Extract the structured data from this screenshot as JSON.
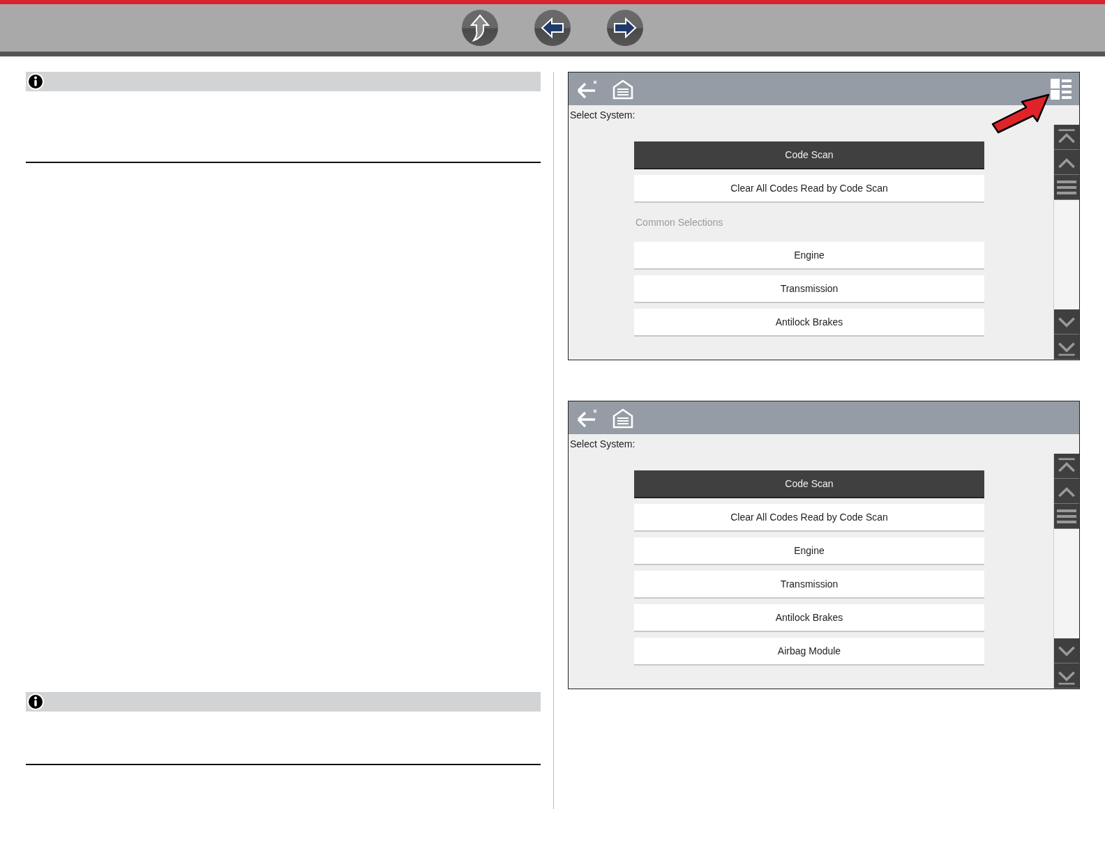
{
  "screens": [
    {
      "title": "Select System:",
      "view_toggle": true,
      "callout_arrow": true,
      "items": [
        {
          "kind": "option",
          "label": "Code Scan",
          "selected": true
        },
        {
          "kind": "option",
          "label": "Clear All Codes Read by Code Scan",
          "selected": false
        },
        {
          "kind": "heading",
          "label": "Common Selections"
        },
        {
          "kind": "option",
          "label": "Engine",
          "selected": false
        },
        {
          "kind": "option",
          "label": "Transmission",
          "selected": false
        },
        {
          "kind": "option",
          "label": "Antilock Brakes",
          "selected": false
        }
      ]
    },
    {
      "title": "Select System:",
      "view_toggle": false,
      "callout_arrow": false,
      "items": [
        {
          "kind": "option",
          "label": "Code Scan",
          "selected": true
        },
        {
          "kind": "option",
          "label": "Clear All Codes Read by Code Scan",
          "selected": false
        },
        {
          "kind": "option",
          "label": "Engine",
          "selected": false
        },
        {
          "kind": "option",
          "label": "Transmission",
          "selected": false
        },
        {
          "kind": "option",
          "label": "Antilock Brakes",
          "selected": false
        },
        {
          "kind": "option",
          "label": "Airbag Module",
          "selected": false
        }
      ]
    }
  ]
}
